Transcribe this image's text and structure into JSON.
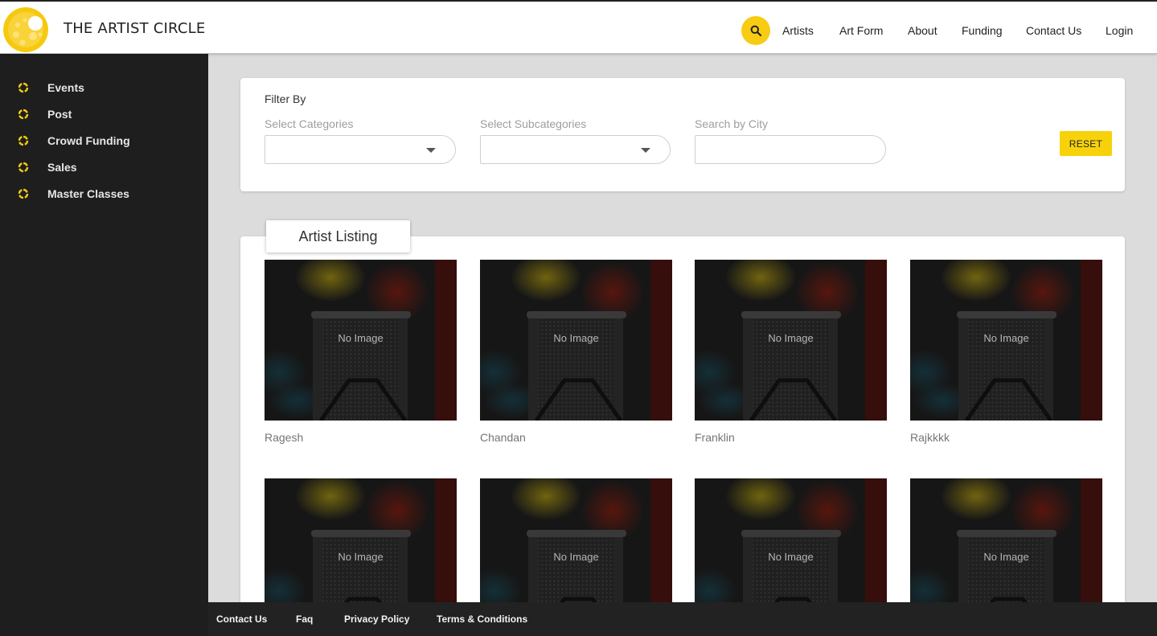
{
  "colors": {
    "accent": "#f7cc12",
    "sidebar_bg": "#1e1e1e",
    "footer_bg": "#222222",
    "page_bg": "#dcdcdc"
  },
  "header": {
    "brand": "THE ARTIST CIRCLE",
    "logo_icon": "artist-circle-logo",
    "search_icon": "search-icon",
    "nav": [
      {
        "label": "Artists"
      },
      {
        "label": "Art Form"
      },
      {
        "label": "About"
      },
      {
        "label": "Funding"
      },
      {
        "label": "Contact Us"
      },
      {
        "label": "Login"
      }
    ]
  },
  "sidebar": {
    "items": [
      {
        "label": "Events",
        "icon": "ring-icon"
      },
      {
        "label": "Post",
        "icon": "ring-icon"
      },
      {
        "label": "Crowd Funding",
        "icon": "ring-icon"
      },
      {
        "label": "Sales",
        "icon": "ring-icon"
      },
      {
        "label": "Master Classes",
        "icon": "ring-icon"
      }
    ]
  },
  "filter": {
    "title": "Filter By",
    "categories_label": "Select Categories",
    "categories_value": "",
    "subcategories_label": "Select Subcategories",
    "subcategories_value": "",
    "city_label": "Search by City",
    "city_value": "",
    "reset_label": "RESET"
  },
  "listing": {
    "tab_label": "Artist Listing",
    "placeholder_text": "No Image",
    "artists": [
      {
        "name": "Ragesh"
      },
      {
        "name": "Chandan"
      },
      {
        "name": "Franklin"
      },
      {
        "name": "Rajkkkk"
      },
      {
        "name": ""
      },
      {
        "name": ""
      },
      {
        "name": ""
      },
      {
        "name": ""
      }
    ]
  },
  "footer": {
    "links": [
      {
        "label": "Contact Us"
      },
      {
        "label": "Faq"
      },
      {
        "label": "Privacy Policy"
      },
      {
        "label": "Terms & Conditions"
      }
    ]
  }
}
